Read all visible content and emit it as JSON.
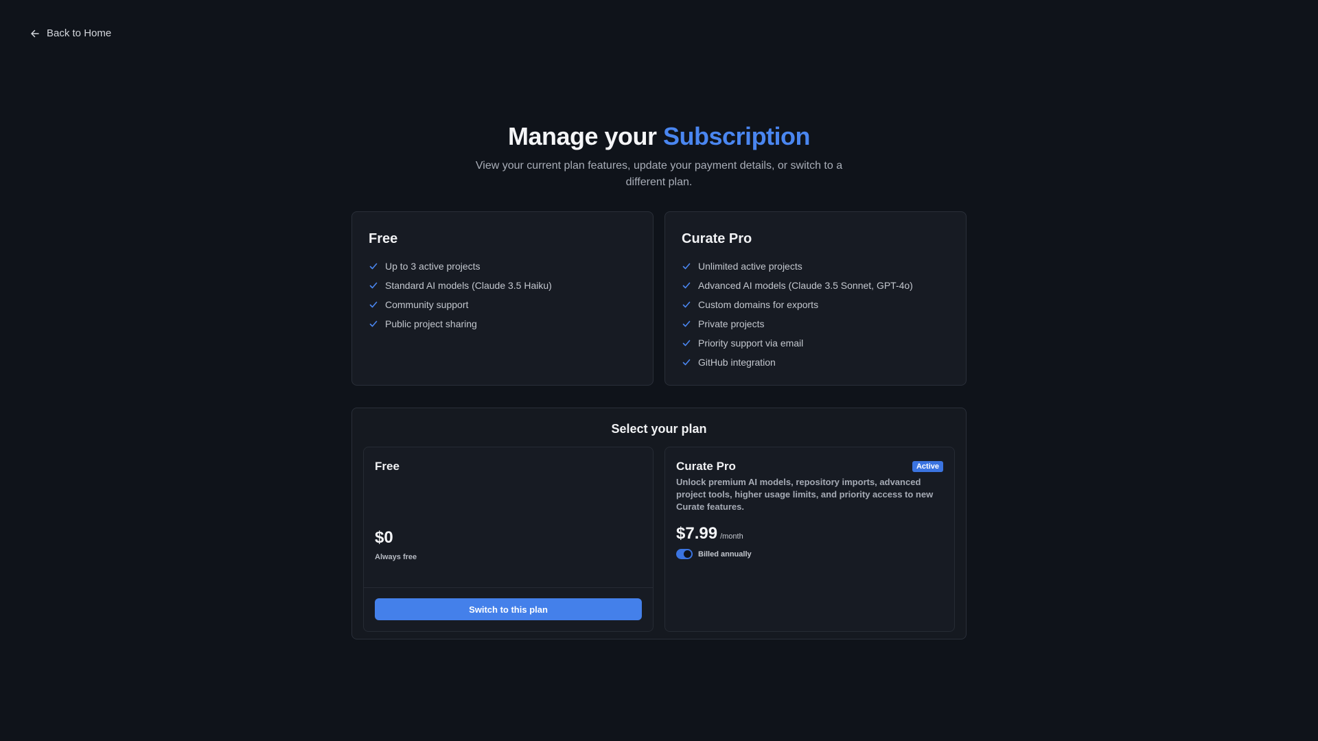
{
  "nav": {
    "back_label": "Back to Home"
  },
  "header": {
    "title_prefix": "Manage your ",
    "title_accent": "Subscription",
    "subtitle": "View your current plan features, update your payment details, or switch to a different plan."
  },
  "features": {
    "free": {
      "name": "Free",
      "items": [
        "Up to 3 active projects",
        "Standard AI models (Claude 3.5 Haiku)",
        "Community support",
        "Public project sharing"
      ]
    },
    "pro": {
      "name": "Curate Pro",
      "items": [
        "Unlimited active projects",
        "Advanced AI models (Claude 3.5 Sonnet, GPT-4o)",
        "Custom domains for exports",
        "Private projects",
        "Priority support via email",
        "GitHub integration"
      ]
    }
  },
  "select": {
    "title": "Select your plan",
    "free": {
      "name": "Free",
      "price": "$0",
      "note": "Always free",
      "button": "Switch to this plan"
    },
    "pro": {
      "name": "Curate Pro",
      "badge": "Active",
      "description": "Unlock premium AI models, repository imports, advanced project tools, higher usage limits, and priority access to new Curate features.",
      "price": "$7.99",
      "per": "/month",
      "billing_label": "Billed annually",
      "billing_annual": true
    }
  },
  "colors": {
    "accent": "#4a86f0",
    "background": "#0f131a",
    "card": "#171b23"
  },
  "icons": {
    "back": "arrow-left-icon",
    "check": "check-icon"
  }
}
